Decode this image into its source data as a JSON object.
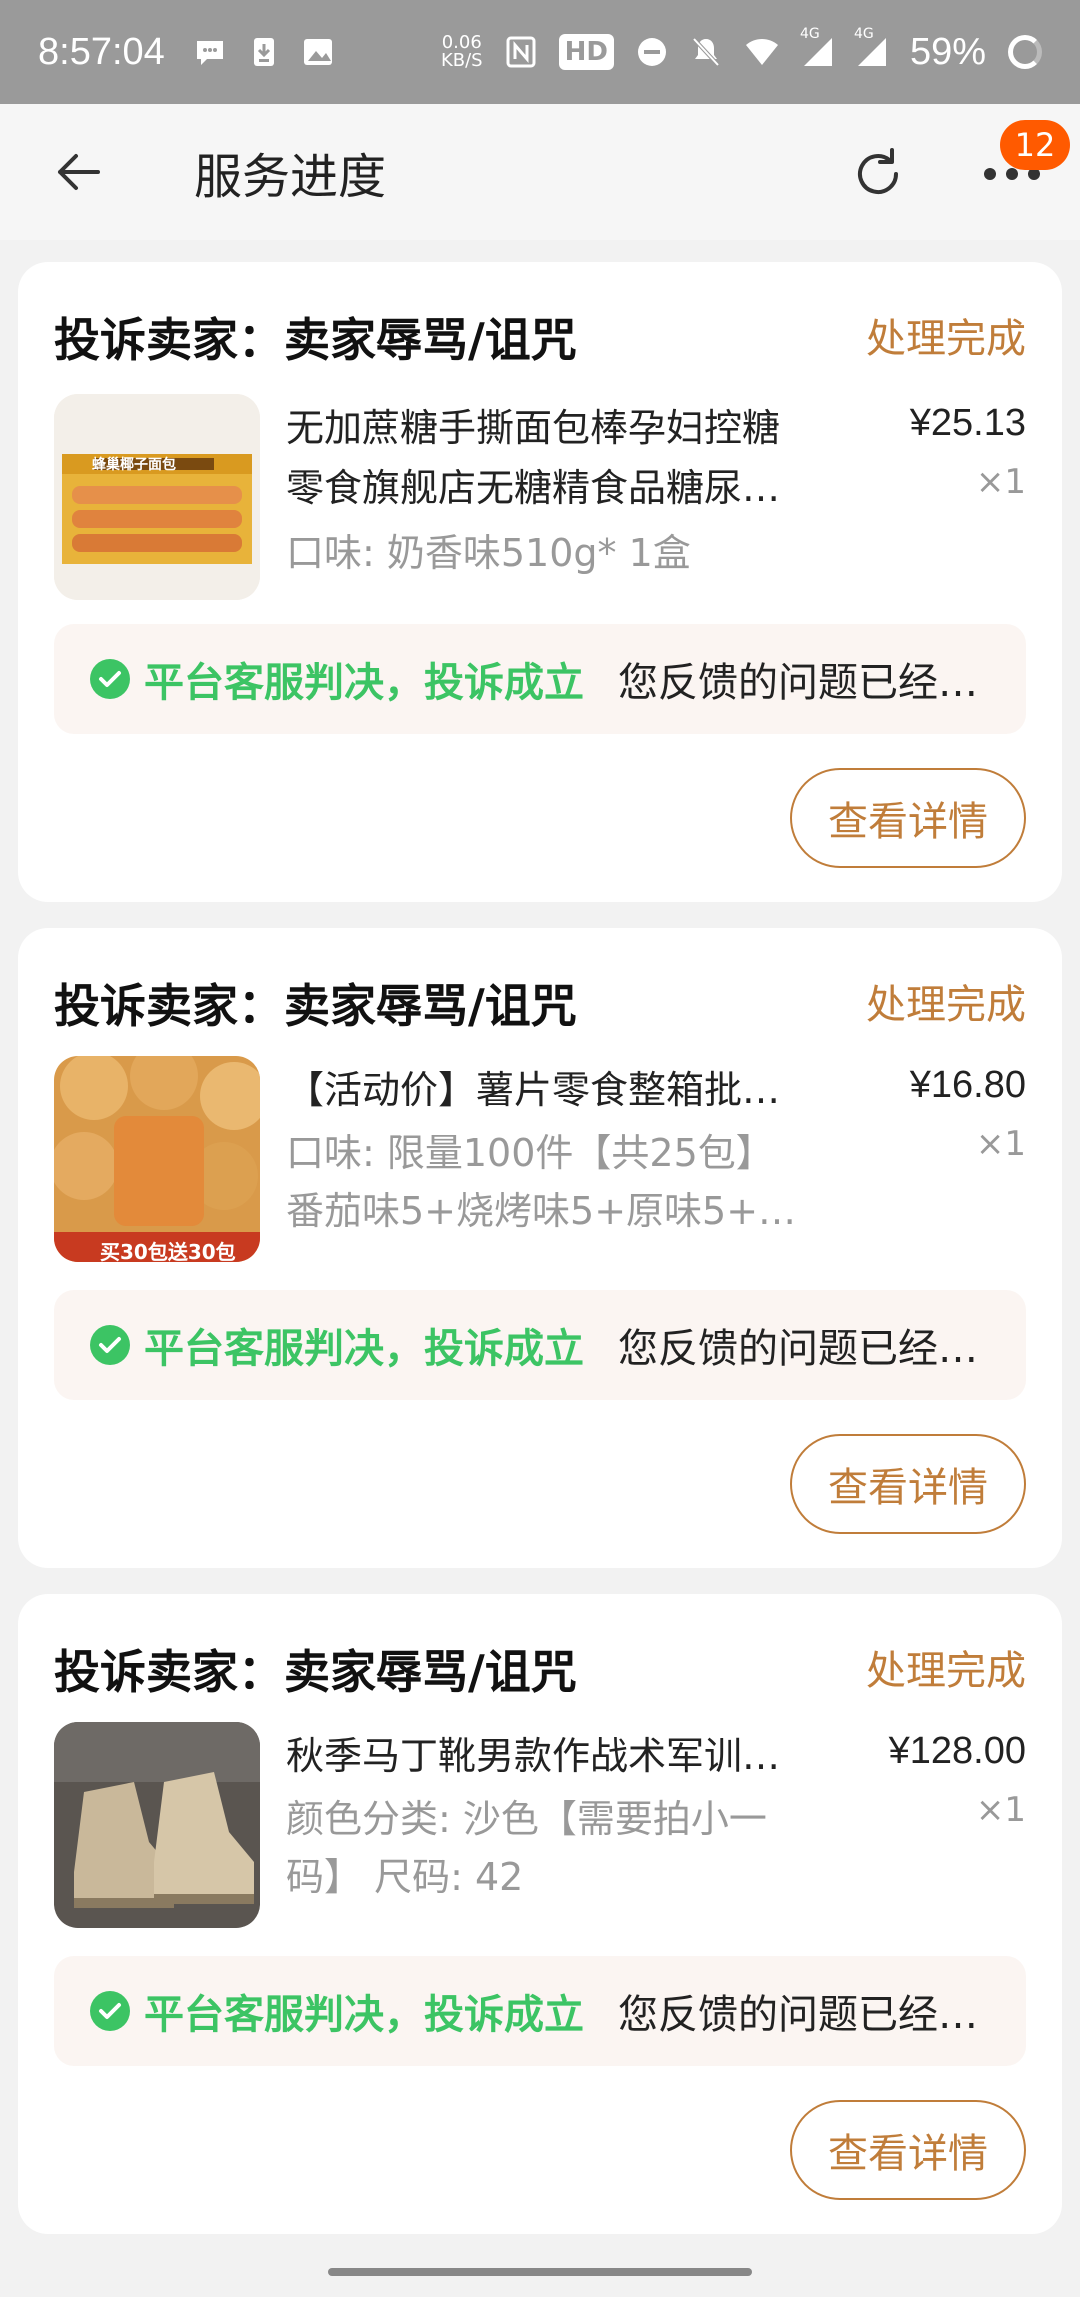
{
  "status_bar": {
    "time": "8:57:04",
    "net_speed_value": "0.06",
    "net_speed_unit": "KB/S",
    "hd_label": "HD",
    "signal_label_1": "4G",
    "signal_label_2": "4G",
    "battery": "59%"
  },
  "nav": {
    "title": "服务进度",
    "badge_count": "12"
  },
  "cards": [
    {
      "title": "投诉卖家：卖家辱骂/诅咒",
      "status": "处理完成",
      "product_line1": "无加蔗糖手撕面包棒孕妇控糖",
      "product_line2": "零食旗舰店无糖精食品糖尿…",
      "price": "¥25.13",
      "qty": "×1",
      "spec_line1": "口味: 奶香味510g* 1盒",
      "spec_line2": "",
      "verdict_title": "平台客服判决，投诉成立",
      "verdict_text": "您反馈的问题已经…",
      "detail_button": "查看详情",
      "thumb_label": "蜂巢椰子面包"
    },
    {
      "title": "投诉卖家：卖家辱骂/诅咒",
      "status": "处理完成",
      "product_line1": "【活动价】薯片零食整箱批…",
      "product_line2": "",
      "price": "¥16.80",
      "qty": "×1",
      "spec_line1": "口味: 限量100件【共25包】",
      "spec_line2": "番茄味5+烧烤味5+原味5+…",
      "verdict_title": "平台客服判决，投诉成立",
      "verdict_text": "您反馈的问题已经…",
      "detail_button": "查看详情",
      "thumb_label": "买30包送30包"
    },
    {
      "title": "投诉卖家：卖家辱骂/诅咒",
      "status": "处理完成",
      "product_line1": "秋季马丁靴男款作战术军训…",
      "product_line2": "",
      "price": "¥128.00",
      "qty": "×1",
      "spec_line1": "颜色分类: 沙色【需要拍小一",
      "spec_line2": "码】 尺码: 42",
      "verdict_title": "平台客服判决，投诉成立",
      "verdict_text": "您反馈的问题已经…",
      "detail_button": "查看详情",
      "thumb_label": ""
    }
  ],
  "colors": {
    "accent": "#c07d3a",
    "success": "#3cc464",
    "badge": "#ff5a00"
  }
}
